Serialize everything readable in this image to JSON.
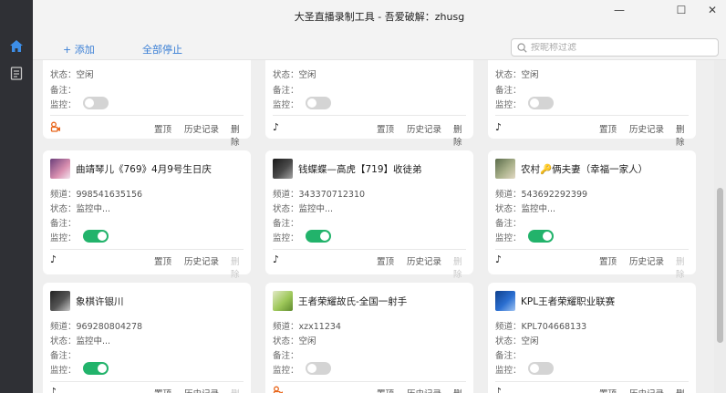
{
  "window": {
    "title": "大圣直播录制工具 - 吾爱破解：zhusg",
    "minimize": "—",
    "maximize": "☐",
    "close": "✕"
  },
  "toolbar": {
    "add_label": "+ 添加",
    "stop_all_label": "全部停止",
    "search_placeholder": "按昵称过滤"
  },
  "labels": {
    "channel": "频道：",
    "status": "状态：",
    "note": "备注：",
    "monitor": "监控：",
    "pin": "置顶",
    "history": "历史记录",
    "delete": "删除"
  },
  "rows": [
    [
      {
        "status": "空闲",
        "monitor": false,
        "platform": "kuaishou",
        "delete_enabled": true
      },
      {
        "status": "空闲",
        "monitor": false,
        "platform": "douyin",
        "delete_enabled": true
      },
      {
        "status": "空闲",
        "monitor": false,
        "platform": "douyin",
        "delete_enabled": true
      }
    ],
    [
      {
        "name": "曲靖琴儿《769》4月9号生日庆",
        "channel": "998541635156",
        "status": "监控中...",
        "monitor": true,
        "platform": "douyin",
        "delete_enabled": false
      },
      {
        "name": "钱蝶蝶—高虎【719】收徒弟",
        "channel": "343370712310",
        "status": "监控中...",
        "monitor": true,
        "platform": "douyin",
        "delete_enabled": false
      },
      {
        "name": "农村🔑俩夫妻（幸福一家人）",
        "channel": "543692292399",
        "status": "监控中...",
        "monitor": true,
        "platform": "douyin",
        "delete_enabled": false
      }
    ],
    [
      {
        "name": "象棋许银川",
        "channel": "969280804278",
        "status": "监控中...",
        "monitor": true,
        "platform": "douyin",
        "delete_enabled": false
      },
      {
        "name": "王者荣耀故氏-全国一射手",
        "channel": "xzx11234",
        "status": "空闲",
        "monitor": false,
        "platform": "kuaishou",
        "delete_enabled": true
      },
      {
        "name": "KPL王者荣耀职业联赛",
        "channel": "KPL704668133",
        "status": "空闲",
        "monitor": false,
        "platform": "douyin",
        "delete_enabled": true
      }
    ]
  ],
  "colors": {
    "accent": "#3a7fd5",
    "toggle_on": "#22b36b",
    "toggle_off": "#d4d4d4",
    "rail": "#2f3035",
    "kuaishou": "#e8651a"
  },
  "icons": {
    "home": "home-icon",
    "list": "document-icon",
    "search": "search-icon",
    "douyin": "douyin-icon",
    "kuaishou": "kuaishou-icon"
  }
}
